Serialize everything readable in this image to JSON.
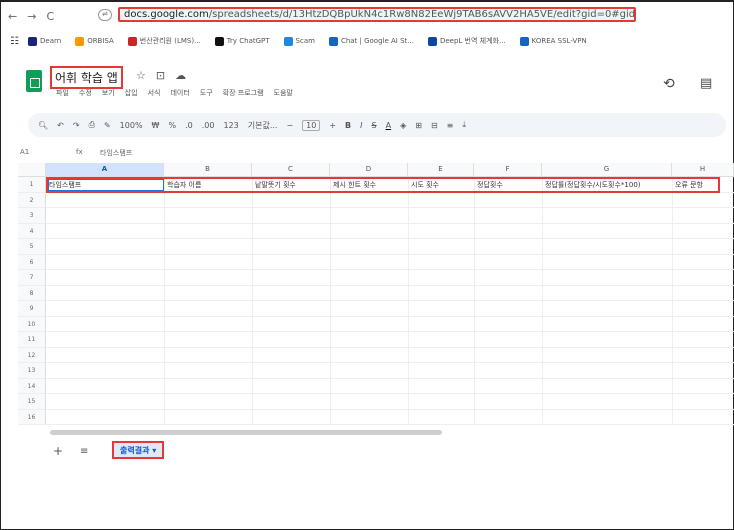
{
  "browser": {
    "nav_back": "←",
    "nav_forward": "→",
    "reload": "C",
    "url_domain": "docs.google.com",
    "url_path": "/spreadsheets/d/13HtzDQBpUkN4c1Rw8N82EeWj9TAB6sAVV2HA5VE/edit?gid=0#gid=0"
  },
  "bookmarks": [
    {
      "label": "Dearn",
      "color": "#1a237e"
    },
    {
      "label": "ORBISA",
      "color": "#ff9800"
    },
    {
      "label": "번산관리원 (LMS)...",
      "color": "#c62828"
    },
    {
      "label": "Try ChatGPT",
      "color": "#111111"
    },
    {
      "label": "Scam",
      "color": "#1e88e5"
    },
    {
      "label": "Chat | Google AI St...",
      "color": "#1565c0"
    },
    {
      "label": "DeepL 번역 체계화...",
      "color": "#0d47a1"
    },
    {
      "label": "KOREA SSL-VPN",
      "color": "#1565c0"
    }
  ],
  "doc": {
    "title": "어휘 학습 앱",
    "star_icon": "☆",
    "move_icon": "⊡",
    "cloud_icon": "☁",
    "menus": [
      "파일",
      "수정",
      "보기",
      "삽입",
      "서식",
      "데이터",
      "도구",
      "확장 프로그램",
      "도움말"
    ]
  },
  "toolbar": {
    "zoom": "100%",
    "currency": "₩",
    "percent": "%",
    "font": "기본값...",
    "font_size": "10",
    "minus": "−",
    "plus": "+",
    "bold": "B",
    "italic": "I",
    "strike": "S",
    "text_color": "A"
  },
  "formula_bar": {
    "cell_ref": "A1",
    "fx": "fx",
    "value": "타임스탬프"
  },
  "grid": {
    "columns": [
      "A",
      "B",
      "C",
      "D",
      "E",
      "F",
      "G",
      "H"
    ],
    "rows": [
      "1",
      "2",
      "3",
      "4",
      "5",
      "6",
      "7",
      "8",
      "9",
      "10",
      "11",
      "12",
      "13",
      "14",
      "15",
      "16"
    ],
    "header_values": [
      "타임스탬프",
      "학습자 이름",
      "낱말뜻기 횟수",
      "제시 힌트 횟수",
      "시도 횟수",
      "정답횟수",
      "정답률(정답횟수/시도횟수*100)",
      "오류 문항"
    ]
  },
  "sheets": {
    "add": "+",
    "all": "≡",
    "active_tab": "출력결과",
    "tab_dropdown": "▾"
  }
}
